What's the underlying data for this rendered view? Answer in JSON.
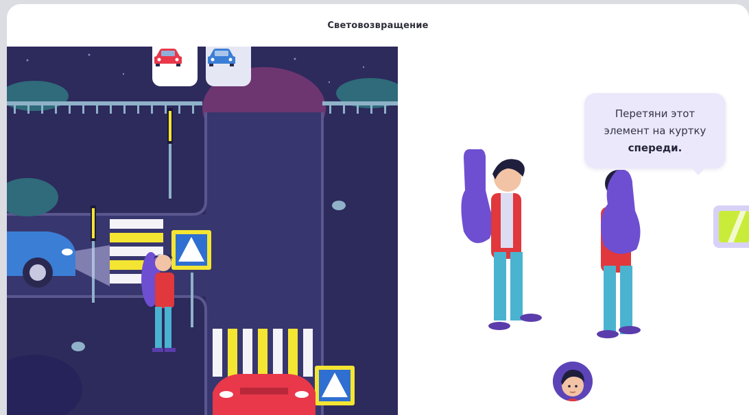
{
  "window": {
    "title": "Световозвращение"
  },
  "scene": {
    "car_options": [
      {
        "name": "red-car",
        "color": "#e8384a",
        "selected": true
      },
      {
        "name": "blue-car",
        "color": "#3b7ed6",
        "selected": false
      }
    ],
    "colors": {
      "sky": "#2d2a5c",
      "road": "#3a3873",
      "crosswalk_white": "#f4f4f8",
      "crosswalk_yellow": "#f4e533",
      "sign_blue": "#2f6fd1",
      "sign_border": "#f4e533"
    }
  },
  "instruction": {
    "line1": "Перетяни этот",
    "line2": "элемент на куртку",
    "line3_bold": "спереди."
  },
  "draggable": {
    "icon": "reflector-strip-icon",
    "color": "#c9ec3a"
  },
  "avatar": {
    "icon": "boy-avatar-icon"
  }
}
